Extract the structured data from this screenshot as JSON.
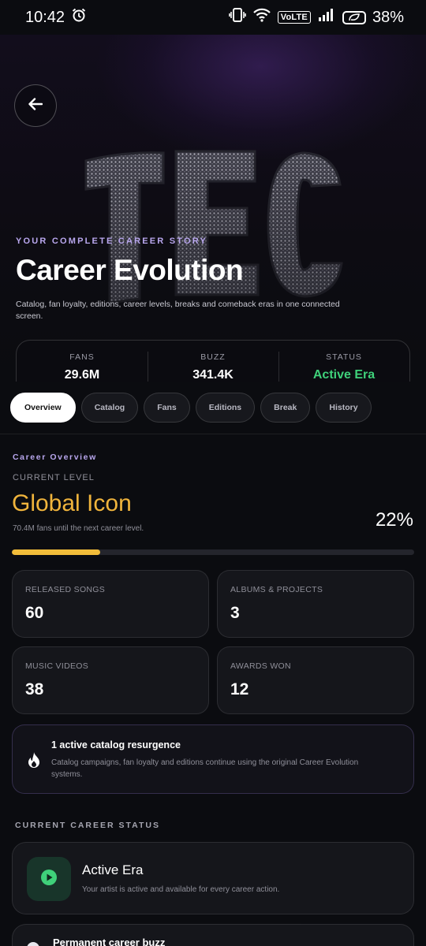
{
  "status_bar": {
    "time": "10:42",
    "network": "VoLTE",
    "battery": "38%",
    "icons": [
      "alarm-icon",
      "vibrate-icon",
      "wifi-icon",
      "signal-icon",
      "battery-saver-icon"
    ]
  },
  "hero": {
    "art_text": "TEC",
    "eyebrow": "YOUR COMPLETE CAREER STORY",
    "title": "Career Evolution",
    "subtitle": "Catalog, fan loyalty, editions, career levels, breaks and comeback eras in one connected screen.",
    "stats": [
      {
        "label": "FANS",
        "value": "29.6M"
      },
      {
        "label": "BUZZ",
        "value": "341.4K"
      },
      {
        "label": "STATUS",
        "value": "Active Era"
      }
    ]
  },
  "tabs": [
    {
      "label": "Overview",
      "active": true
    },
    {
      "label": "Catalog"
    },
    {
      "label": "Fans"
    },
    {
      "label": "Editions"
    },
    {
      "label": "Break"
    },
    {
      "label": "History"
    }
  ],
  "overview": {
    "section_title": "Career Overview",
    "level_caption": "CURRENT LEVEL",
    "level_name": "Global Icon",
    "level_note": "70.4M fans until the next career level.",
    "progress_percent_label": "22%",
    "progress_value": 22,
    "metrics": [
      {
        "label": "RELEASED SONGS",
        "value": "60"
      },
      {
        "label": "ALBUMS & PROJECTS",
        "value": "3"
      },
      {
        "label": "MUSIC VIDEOS",
        "value": "38"
      },
      {
        "label": "AWARDS WON",
        "value": "12"
      }
    ],
    "resurgence": {
      "title": "1 active catalog resurgence",
      "text": "Catalog campaigns, fan loyalty and editions continue using the original Career Evolution systems."
    }
  },
  "career_status": {
    "section_title": "CURRENT CAREER STATUS",
    "status_title": "Active Era",
    "status_text": "Your artist is active and available for every career action.",
    "buzz_title": "Permanent career buzz"
  },
  "colors": {
    "accent_purple": "#b9a7ee",
    "level_gold": "#f0b43c",
    "progress": "#f2bd3a",
    "active_green": "#3fd17a"
  }
}
